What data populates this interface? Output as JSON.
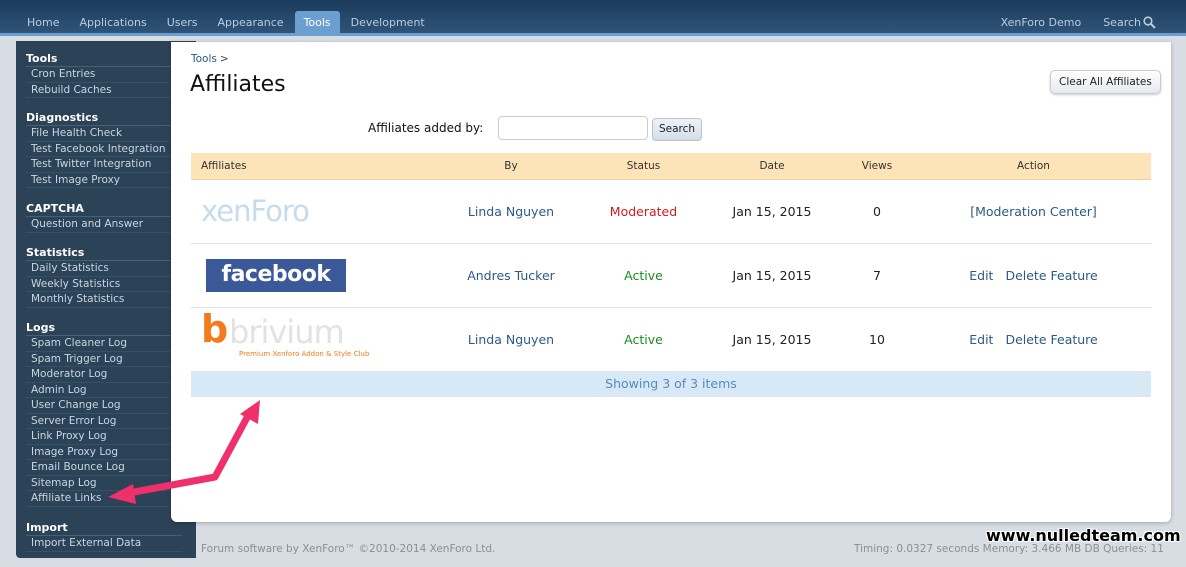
{
  "topnav": {
    "tabs": [
      {
        "label": "Home"
      },
      {
        "label": "Applications"
      },
      {
        "label": "Users"
      },
      {
        "label": "Appearance"
      },
      {
        "label": "Tools",
        "active": true
      },
      {
        "label": "Development"
      }
    ],
    "site_name": "XenForo Demo",
    "search_label": "Search"
  },
  "sidebar": {
    "groups": [
      {
        "title": "Tools",
        "items": [
          "Cron Entries",
          "Rebuild Caches"
        ]
      },
      {
        "title": "Diagnostics",
        "items": [
          "File Health Check",
          "Test Facebook Integration",
          "Test Twitter Integration",
          "Test Image Proxy"
        ]
      },
      {
        "title": "CAPTCHA",
        "items": [
          "Question and Answer"
        ]
      },
      {
        "title": "Statistics",
        "items": [
          "Daily Statistics",
          "Weekly Statistics",
          "Monthly Statistics"
        ]
      },
      {
        "title": "Logs",
        "items": [
          "Spam Cleaner Log",
          "Spam Trigger Log",
          "Moderator Log",
          "Admin Log",
          "User Change Log",
          "Server Error Log",
          "Link Proxy Log",
          "Image Proxy Log",
          "Email Bounce Log",
          "Sitemap Log",
          "Affiliate Links"
        ]
      },
      {
        "title": "Import",
        "items": [
          "Import External Data"
        ]
      }
    ]
  },
  "main": {
    "breadcrumb": "Tools",
    "breadcrumb_sep": ">",
    "title": "Affiliates",
    "clear_button": "Clear All Affiliates",
    "filter_label": "Affiliates added by:",
    "filter_value": "",
    "search_button": "Search",
    "columns": [
      "Affiliates",
      "By",
      "Status",
      "Date",
      "Views",
      "Action"
    ],
    "rows": [
      {
        "logo": "xenforo",
        "logo_text": "xenForo",
        "by": "Linda Nguyen",
        "status": "Moderated",
        "date": "Jan 15, 2015",
        "views": "0",
        "actions": [
          "[Moderation Center]"
        ]
      },
      {
        "logo": "facebook",
        "logo_text": "facebook",
        "by": "Andres Tucker",
        "status": "Active",
        "date": "Jan 15, 2015",
        "views": "7",
        "actions": [
          "Edit",
          "Delete Feature"
        ]
      },
      {
        "logo": "brivium",
        "logo_text": "brivium",
        "logo_tagline": "Premium Xenforo Addon & Style Club",
        "by": "Linda Nguyen",
        "status": "Active",
        "date": "Jan 15, 2015",
        "views": "10",
        "actions": [
          "Edit",
          "Delete Feature"
        ]
      }
    ],
    "footer": "Showing 3 of 3 items"
  },
  "page_footer": {
    "copyright": "Forum software by XenForo™ ©2010-2014 XenForo Ltd.",
    "timing": "Timing: 0.0327 seconds Memory: 3.466 MB DB Queries: 11"
  },
  "watermark": "www.nulledteam.com",
  "colors": {
    "nav_bg": "#1f4266",
    "active_tab": "#6a9fd0",
    "sidebar_bg": "#2c4257",
    "status_moderated": "#d11b1b",
    "status_active": "#1d8a1d",
    "link": "#2b5a87",
    "table_header": "#fde3b8",
    "arrow": "#f0306a"
  }
}
